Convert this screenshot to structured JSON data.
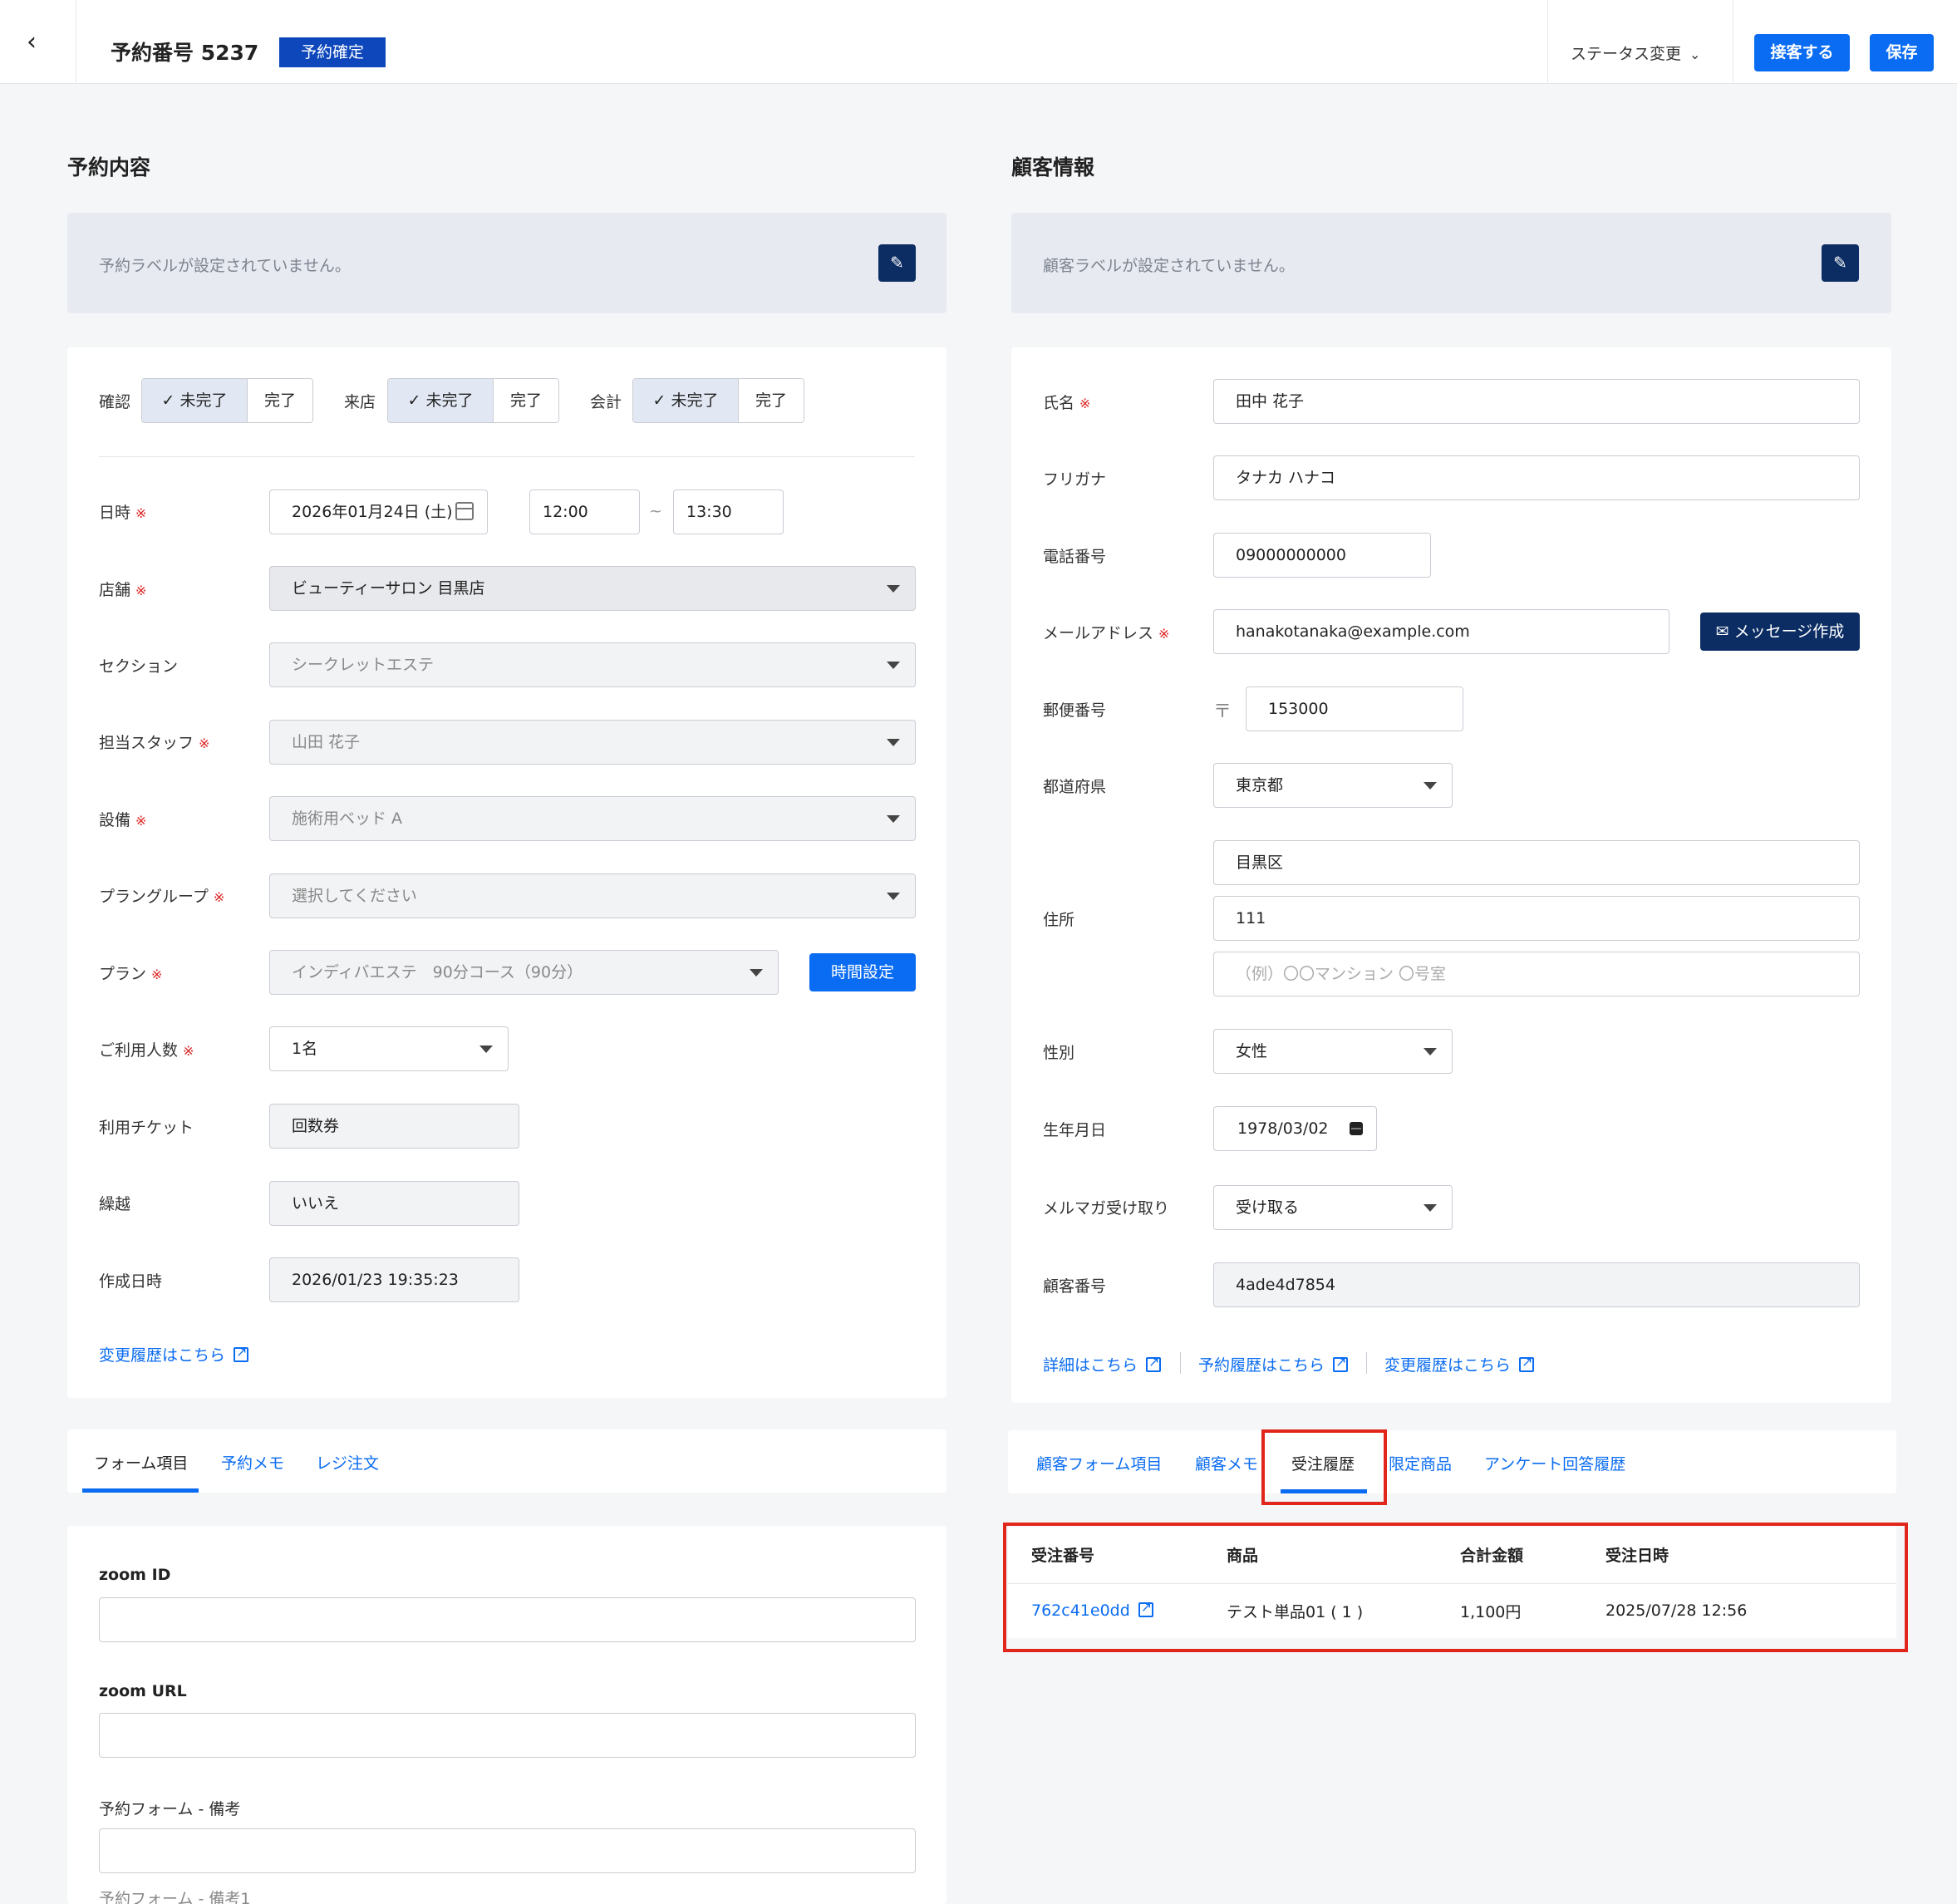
{
  "header": {
    "back_icon": "‹",
    "title": "予約番号 5237",
    "status_badge": "予約確定",
    "status_change": "ステータス変更",
    "chevron": "⌄",
    "reception_button": "接客する",
    "save_button": "保存"
  },
  "reservation": {
    "heading": "予約内容",
    "label_empty": "予約ラベルが設定されていません。",
    "edit_icon": "✎",
    "status_groups": [
      {
        "label": "確認",
        "incomplete": "✓ 未完了",
        "complete": "完了"
      },
      {
        "label": "来店",
        "incomplete": "✓ 未完了",
        "complete": "完了"
      },
      {
        "label": "会計",
        "incomplete": "✓ 未完了",
        "complete": "完了"
      }
    ],
    "fields": {
      "datetime_label": "日時",
      "date": "2026年01月24日 (土)",
      "start_time": "12:00",
      "tilde": "~",
      "end_time": "13:30",
      "store_label": "店舗",
      "store": "ビューティーサロン 目黒店",
      "section_label": "セクション",
      "section": "シークレットエステ",
      "staff_label": "担当スタッフ",
      "staff": "山田 花子",
      "equipment_label": "設備",
      "equipment": "施術用ベッド A",
      "plan_group_label": "プラングループ",
      "plan_group": "選択してください",
      "plan_label": "プラン",
      "plan": "インディバエステ　90分コース（90分）",
      "time_setting_button": "時間設定",
      "people_label": "ご利用人数",
      "people": "1名",
      "ticket_label": "利用チケット",
      "ticket": "回数券",
      "carryover_label": "繰越",
      "carryover": "いいえ",
      "created_label": "作成日時",
      "created": "2026/01/23 19:35:23"
    },
    "required_mark": "※",
    "history_link": "変更履歴はこちら"
  },
  "customer": {
    "heading": "顧客情報",
    "label_empty": "顧客ラベルが設定されていません。",
    "edit_icon": "✎",
    "name_label": "氏名",
    "name": "田中 花子",
    "kana_label": "フリガナ",
    "kana": "タナカ ハナコ",
    "phone_label": "電話番号",
    "phone": "09000000000",
    "email_label": "メールアドレス",
    "email": "hanakotanaka@example.com",
    "message_button": "✉ メッセージ作成",
    "postal_label": "郵便番号",
    "postal_mark": "〒",
    "postal": "153000",
    "prefecture_label": "都道府県",
    "prefecture": "東京都",
    "address_label": "住所",
    "address1": "目黒区",
    "address2": "111",
    "address3_placeholder": "（例）〇〇マンション 〇号室",
    "gender_label": "性別",
    "gender": "女性",
    "birthday_label": "生年月日",
    "birthday": "1978/03/02",
    "newsletter_label": "メルマガ受け取り",
    "newsletter": "受け取る",
    "customer_no_label": "顧客番号",
    "customer_no": "4ade4d7854",
    "links": [
      "詳細はこちら",
      "予約履歴はこちら",
      "変更履歴はこちら"
    ]
  },
  "left_tabs": [
    "フォーム項目",
    "予約メモ",
    "レジ注文"
  ],
  "form_items": {
    "zoom_id_label": "zoom ID",
    "zoom_url_label": "zoom URL",
    "note_label": "予約フォーム - 備考",
    "note1_label": "予約フォーム - 備考1"
  },
  "right_tabs": [
    "顧客フォーム項目",
    "顧客メモ",
    "受注履歴",
    "限定商品",
    "アンケート回答履歴"
  ],
  "orders": {
    "headers": [
      "受注番号",
      "商品",
      "合計金額",
      "受注日時"
    ],
    "rows": [
      {
        "order_no": "762c41e0dd",
        "product": "テスト単品01 ( 1 )",
        "total": "1,100円",
        "date": "2025/07/28 12:56"
      }
    ]
  }
}
